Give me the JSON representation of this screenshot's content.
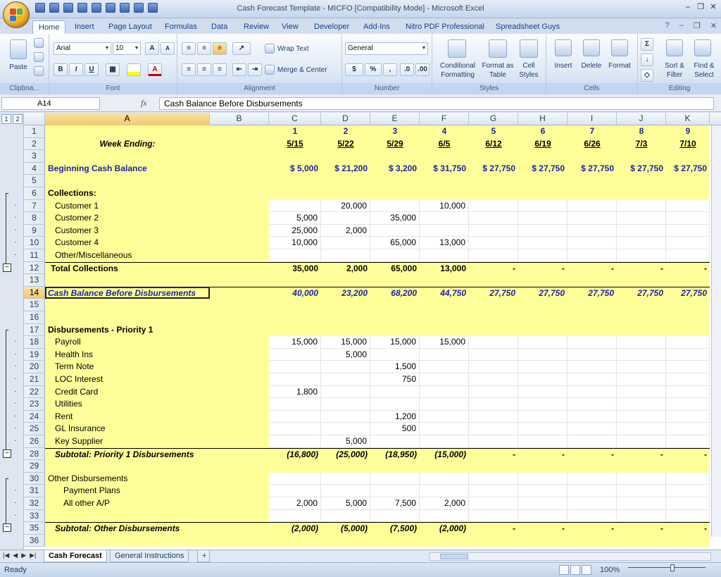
{
  "window": {
    "title": "Cash Forecast Template - MICFO  [Compatibility Mode] - Microsoft Excel"
  },
  "tabs": [
    "Home",
    "Insert",
    "Page Layout",
    "Formulas",
    "Data",
    "Review",
    "View",
    "Developer",
    "Add-Ins",
    "Nitro PDF Professional",
    "Spreadsheet Guys"
  ],
  "ribbon": {
    "clipboard": {
      "label": "Clipboa...",
      "paste": "Paste"
    },
    "font": {
      "label": "Font",
      "name": "Arial",
      "size": "10",
      "bold": "B",
      "italic": "I",
      "underline": "U",
      "grow": "A",
      "shrink": "A",
      "color": "A"
    },
    "alignment": {
      "label": "Alignment",
      "wrap": "Wrap Text",
      "merge": "Merge & Center"
    },
    "number": {
      "label": "Number",
      "format": "General",
      "currency": "$",
      "percent": "%",
      "comma": ","
    },
    "styles": {
      "label": "Styles",
      "conditional_1": "Conditional",
      "conditional_2": "Formatting",
      "format_table_1": "Format as",
      "format_table_2": "Table",
      "cell_styles_1": "Cell",
      "cell_styles_2": "Styles"
    },
    "cells": {
      "label": "Cells",
      "insert": "Insert",
      "delete": "Delete",
      "format": "Format"
    },
    "editing": {
      "label": "Editing",
      "sort_1": "Sort &",
      "sort_2": "Filter",
      "find_1": "Find &",
      "find_2": "Select"
    }
  },
  "formula_bar": {
    "name_box": "A14",
    "fx": "fx",
    "content": "Cash Balance Before Disbursements"
  },
  "outline_levels": [
    "1",
    "2"
  ],
  "columns": [
    "A",
    "B",
    "C",
    "D",
    "E",
    "F",
    "G",
    "H",
    "I",
    "J",
    "K"
  ],
  "rows": [
    {
      "n": "1",
      "c": [
        "",
        "",
        "1",
        "2",
        "3",
        "4",
        "5",
        "6",
        "7",
        "8",
        "9"
      ]
    },
    {
      "n": "2",
      "c": [
        "Week Ending:",
        "",
        "5/15",
        "5/22",
        "5/29",
        "6/5",
        "6/12",
        "6/19",
        "6/26",
        "7/3",
        "7/10"
      ]
    },
    {
      "n": "3",
      "c": [
        "",
        "",
        "",
        "",
        "",
        "",
        "",
        "",
        "",
        "",
        ""
      ]
    },
    {
      "n": "4",
      "c": [
        "Beginning Cash Balance",
        "",
        "$     5,000",
        "$  21,200",
        "$    3,200",
        "$  31,750",
        "$  27,750",
        "$  27,750",
        "$  27,750",
        "$  27,750",
        "$  27,750"
      ]
    },
    {
      "n": "5",
      "c": [
        "",
        "",
        "",
        "",
        "",
        "",
        "",
        "",
        "",
        "",
        ""
      ]
    },
    {
      "n": "6",
      "c": [
        "Collections:",
        "",
        "",
        "",
        "",
        "",
        "",
        "",
        "",
        "",
        ""
      ]
    },
    {
      "n": "7",
      "c": [
        "Customer 1",
        "",
        "",
        "20,000",
        "",
        "10,000",
        "",
        "",
        "",
        "",
        ""
      ]
    },
    {
      "n": "8",
      "c": [
        "Customer 2",
        "",
        "5,000",
        "",
        "35,000",
        "",
        "",
        "",
        "",
        "",
        ""
      ]
    },
    {
      "n": "9",
      "c": [
        "Customer 3",
        "",
        "25,000",
        "2,000",
        "",
        "",
        "",
        "",
        "",
        "",
        ""
      ]
    },
    {
      "n": "10",
      "c": [
        "Customer 4",
        "",
        "10,000",
        "",
        "65,000",
        "13,000",
        "",
        "",
        "",
        "",
        ""
      ]
    },
    {
      "n": "11",
      "c": [
        "Other/Miscellaneous",
        "",
        "",
        "",
        "",
        "",
        "",
        "",
        "",
        "",
        ""
      ]
    },
    {
      "n": "12",
      "c": [
        "Total Collections",
        "",
        "35,000",
        "2,000",
        "65,000",
        "13,000",
        "-",
        "-",
        "-",
        "-",
        "-"
      ]
    },
    {
      "n": "13",
      "c": [
        "",
        "",
        "",
        "",
        "",
        "",
        "",
        "",
        "",
        "",
        ""
      ]
    },
    {
      "n": "14",
      "c": [
        "Cash Balance Before Disbursements",
        "",
        "40,000",
        "23,200",
        "68,200",
        "44,750",
        "27,750",
        "27,750",
        "27,750",
        "27,750",
        "27,750"
      ]
    },
    {
      "n": "15",
      "c": [
        "",
        "",
        "",
        "",
        "",
        "",
        "",
        "",
        "",
        "",
        ""
      ]
    },
    {
      "n": "16",
      "c": [
        "",
        "",
        "",
        "",
        "",
        "",
        "",
        "",
        "",
        "",
        ""
      ]
    },
    {
      "n": "17",
      "c": [
        "Disbursements  - Priority 1",
        "",
        "",
        "",
        "",
        "",
        "",
        "",
        "",
        "",
        ""
      ]
    },
    {
      "n": "18",
      "c": [
        "Payroll",
        "",
        "15,000",
        "15,000",
        "15,000",
        "15,000",
        "",
        "",
        "",
        "",
        ""
      ]
    },
    {
      "n": "19",
      "c": [
        "Health Ins",
        "",
        "",
        "5,000",
        "",
        "",
        "",
        "",
        "",
        "",
        ""
      ]
    },
    {
      "n": "20",
      "c": [
        "Term Note",
        "",
        "",
        "",
        "1,500",
        "",
        "",
        "",
        "",
        "",
        ""
      ]
    },
    {
      "n": "21",
      "c": [
        "LOC Interest",
        "",
        "",
        "",
        "750",
        "",
        "",
        "",
        "",
        "",
        ""
      ]
    },
    {
      "n": "22",
      "c": [
        "Credit Card",
        "",
        "1,800",
        "",
        "",
        "",
        "",
        "",
        "",
        "",
        ""
      ]
    },
    {
      "n": "23",
      "c": [
        "Utilities",
        "",
        "",
        "",
        "",
        "",
        "",
        "",
        "",
        "",
        ""
      ]
    },
    {
      "n": "24",
      "c": [
        "Rent",
        "",
        "",
        "",
        "1,200",
        "",
        "",
        "",
        "",
        "",
        ""
      ]
    },
    {
      "n": "25",
      "c": [
        "GL Insurance",
        "",
        "",
        "",
        "500",
        "",
        "",
        "",
        "",
        "",
        ""
      ]
    },
    {
      "n": "26",
      "c": [
        "Key Supplier",
        "",
        "",
        "5,000",
        "",
        "",
        "",
        "",
        "",
        "",
        ""
      ]
    },
    {
      "n": "28",
      "c": [
        "Subtotal: Priority 1 Disbursements",
        "",
        "(16,800)",
        "(25,000)",
        "(18,950)",
        "(15,000)",
        "-",
        "-",
        "-",
        "-",
        "-"
      ]
    },
    {
      "n": "29",
      "c": [
        "",
        "",
        "",
        "",
        "",
        "",
        "",
        "",
        "",
        "",
        ""
      ]
    },
    {
      "n": "30",
      "c": [
        "Other Disbursements",
        "",
        "",
        "",
        "",
        "",
        "",
        "",
        "",
        "",
        ""
      ]
    },
    {
      "n": "31",
      "c": [
        "Payment Plans",
        "",
        "",
        "",
        "",
        "",
        "",
        "",
        "",
        "",
        ""
      ]
    },
    {
      "n": "32",
      "c": [
        "All other A/P",
        "",
        "2,000",
        "5,000",
        "7,500",
        "2,000",
        "",
        "",
        "",
        "",
        ""
      ]
    },
    {
      "n": "33",
      "c": [
        "",
        "",
        "",
        "",
        "",
        "",
        "",
        "",
        "",
        "",
        ""
      ]
    },
    {
      "n": "35",
      "c": [
        "Subtotal: Other Disbursements",
        "",
        "(2,000)",
        "(5,000)",
        "(7,500)",
        "(2,000)",
        "-",
        "-",
        "-",
        "-",
        "-"
      ]
    },
    {
      "n": "36",
      "c": [
        "",
        "",
        "",
        "",
        "",
        "",
        "",
        "",
        "",
        "",
        ""
      ]
    }
  ],
  "sheet_tabs": [
    "Cash Forecast",
    "General Instructions"
  ],
  "status": {
    "ready": "Ready",
    "zoom": "100%"
  }
}
